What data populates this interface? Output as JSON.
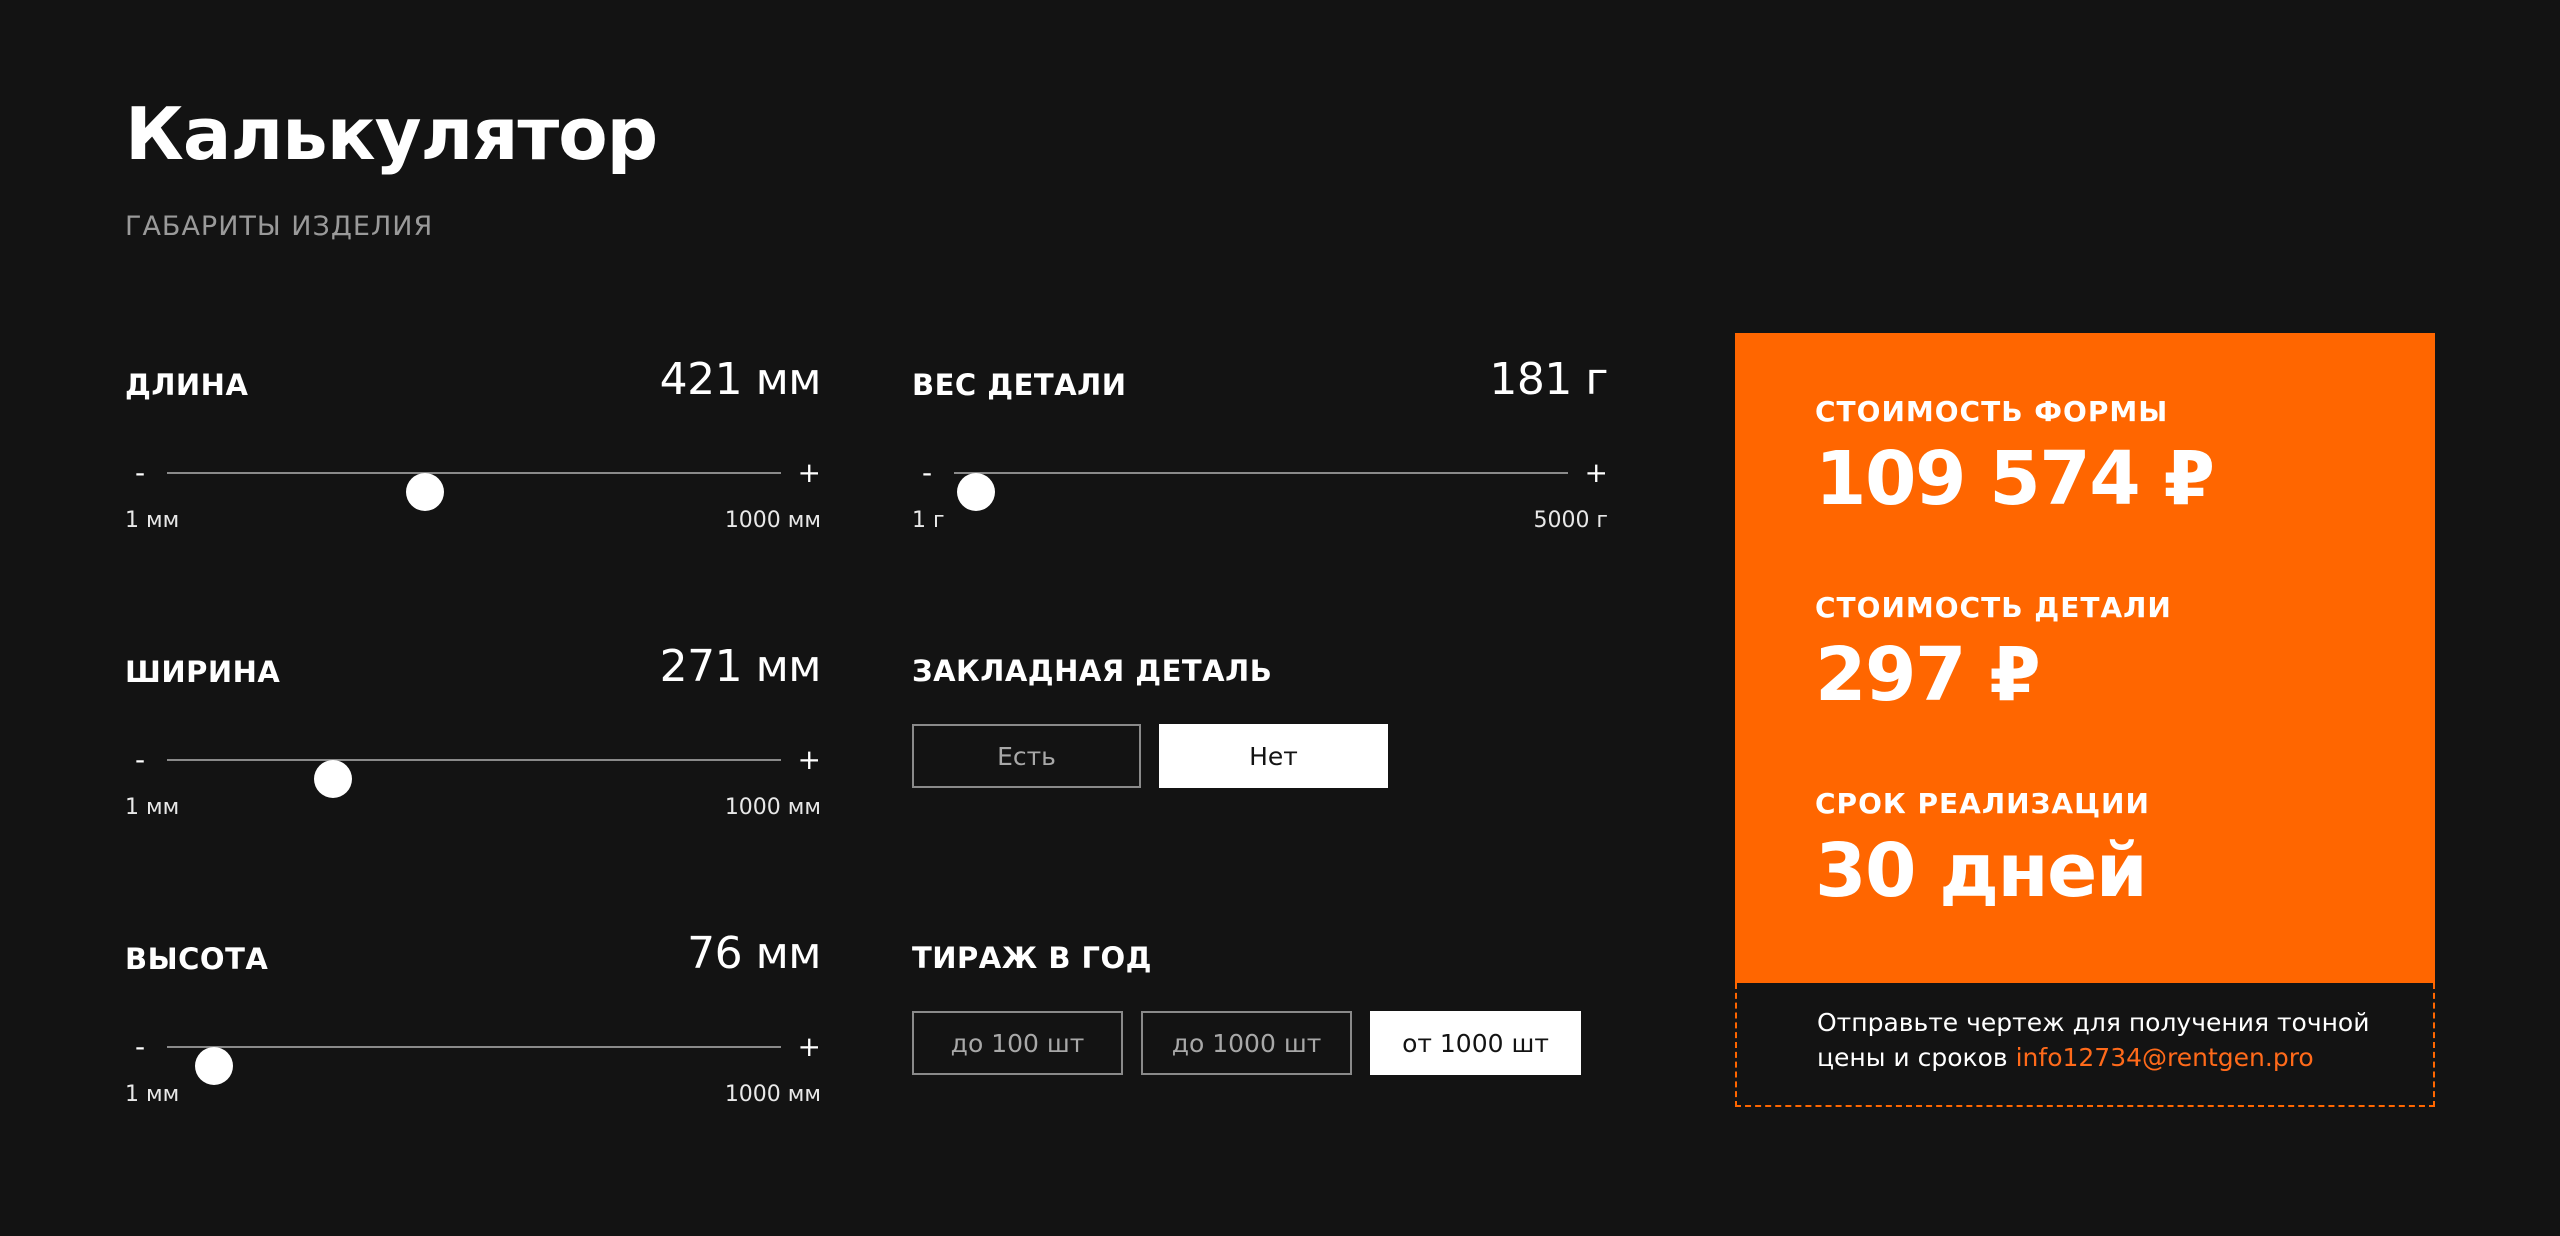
{
  "header": {
    "title": "Калькулятор",
    "subtitle": "ГАБАРИТЫ ИЗДЕЛИЯ"
  },
  "sliders": {
    "length": {
      "label": "ДЛИНА",
      "value": "421 мм",
      "min_label": "1 мм",
      "max_label": "1000 мм",
      "minus": "-",
      "plus": "+",
      "position": 0.421
    },
    "width": {
      "label": "ШИРИНА",
      "value": "271 мм",
      "min_label": "1 мм",
      "max_label": "1000 мм",
      "minus": "-",
      "plus": "+",
      "position": 0.271
    },
    "height": {
      "label": "ВЫСОТА",
      "value": "76 мм",
      "min_label": "1 мм",
      "max_label": "1000 мм",
      "minus": "-",
      "plus": "+",
      "position": 0.076
    },
    "weight": {
      "label": "ВЕС ДЕТАЛИ",
      "value": "181 г",
      "min_label": "1 г",
      "max_label": "5000 г",
      "minus": "-",
      "plus": "+",
      "position": 0.036
    }
  },
  "insert": {
    "label": "ЗАКЛАДНАЯ ДЕТАЛЬ",
    "options": [
      "Есть",
      "Нет"
    ],
    "selected": "Нет"
  },
  "volume": {
    "label": "ТИРАЖ В ГОД",
    "options": [
      "до 100 шт",
      "до 1000 шт",
      "от 1000 шт"
    ],
    "selected": "от 1000 шт"
  },
  "result": {
    "mold_cost_label": "СТОИМОСТЬ ФОРМЫ",
    "mold_cost_value": "109 574 ₽",
    "part_cost_label": "СТОИМОСТЬ ДЕТАЛИ",
    "part_cost_value": "297 ₽",
    "term_label": "СРОК РЕАЛИЗАЦИИ",
    "term_value": "30 дней",
    "note_text": "Отправьте чертеж для получения точной цены и сроков ",
    "note_email": "info12734@rentgen.pro"
  },
  "colors": {
    "background": "#131313",
    "accent": "#ff6600",
    "text": "#ffffff",
    "muted": "#9a9a9a"
  }
}
